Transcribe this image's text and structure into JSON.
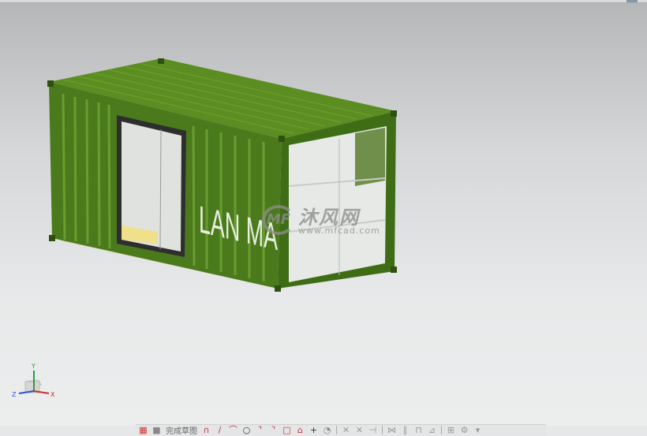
{
  "viewport": {
    "model_text": "LAN MA",
    "watermark": {
      "brand": "沐风网",
      "url": "www.mfcad.com",
      "logo": "MF"
    }
  },
  "triad": {
    "x": "X",
    "y": "Y",
    "z": "Z"
  },
  "toolbar": {
    "finish_sketch_label": "完成草图",
    "icons": [
      "profile-icon",
      "line-icon",
      "arc-icon",
      "circle-icon",
      "fillet-icon",
      "chamfer-icon",
      "rectangle-icon",
      "polygon-icon",
      "point-icon",
      "offset-icon",
      "trim-icon",
      "extend-icon",
      "corner-icon",
      "mirror-icon",
      "constraint-icon",
      "dimension-icon",
      "relation-icon",
      "display-icon",
      "settings-icon",
      "more-icon"
    ]
  },
  "colors": {
    "container": "#4a7a1c",
    "container_dark": "#355a12",
    "glass": "#e9ecea"
  }
}
